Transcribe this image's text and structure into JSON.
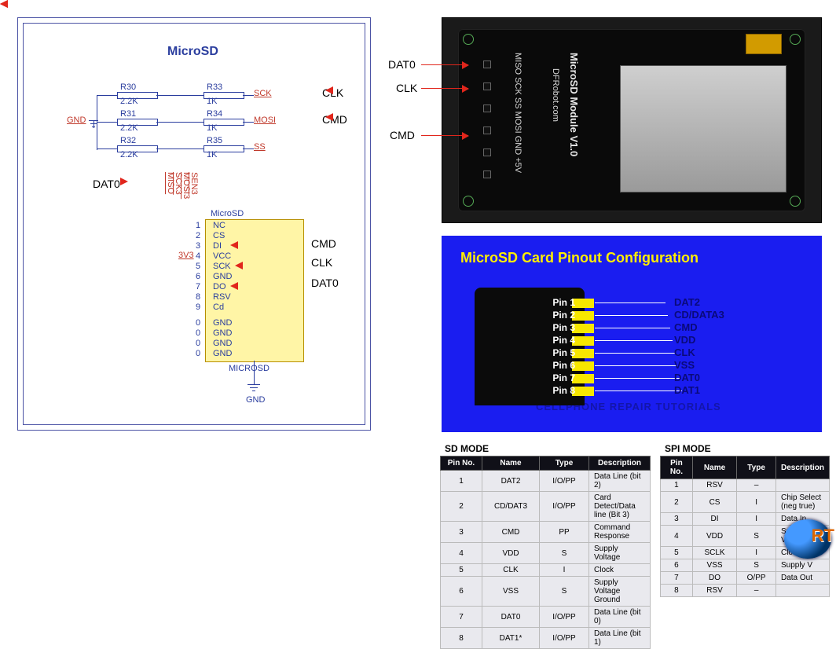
{
  "schematic": {
    "title": "MicroSD",
    "chip_title": "MicroSD",
    "chip_footer": "MICROSD",
    "gnd": "GND",
    "v33": "3V3",
    "components": {
      "R30": {
        "ref": "R30",
        "val": "2.2K"
      },
      "R31": {
        "ref": "R31",
        "val": "2.2K"
      },
      "R32": {
        "ref": "R32",
        "val": "2.2K"
      },
      "R33": {
        "ref": "R33",
        "val": "1K"
      },
      "R34": {
        "ref": "R34",
        "val": "1K"
      },
      "R35": {
        "ref": "R35",
        "val": "1K"
      }
    },
    "signals": {
      "sck": "SCK",
      "mosi": "MOSI",
      "ss": "SS",
      "miso": "MISO",
      "sck3": "SCK3",
      "mosi3": "MOSI3",
      "sen3": "SEN3"
    },
    "chip_pins": [
      "NC",
      "CS",
      "DI",
      "VCC",
      "SCK",
      "GND",
      "DO",
      "RSV",
      "Cd"
    ],
    "chip_gnd_pins": [
      "GND",
      "GND",
      "GND",
      "GND"
    ],
    "mapping": {
      "di": "CMD",
      "sck": "CLK",
      "do": "DAT0"
    },
    "callouts": {
      "clk": "CLK",
      "cmd": "CMD",
      "dat0": "DAT0"
    }
  },
  "module": {
    "title_big": "MicroSD Module V1.0",
    "brand": "DFRobot.com",
    "pin_labels": "MISO SCK  SS MOSI GND  +5V",
    "callouts": {
      "dat0": "DAT0",
      "clk": "CLK",
      "cmd": "CMD"
    }
  },
  "pinout": {
    "title": "MicroSD Card Pinout Configuration",
    "pins": [
      {
        "n": "Pin 1",
        "fn": "DAT2"
      },
      {
        "n": "Pin 2",
        "fn": "CD/DATA3"
      },
      {
        "n": "Pin 3",
        "fn": "CMD"
      },
      {
        "n": "Pin 4",
        "fn": "VDD"
      },
      {
        "n": "Pin 5",
        "fn": "CLK"
      },
      {
        "n": "Pin 6",
        "fn": "VSS"
      },
      {
        "n": "Pin 7",
        "fn": "DAT0"
      },
      {
        "n": "Pin 8",
        "fn": "DAT1"
      }
    ],
    "watermark": "CELLPHONE REPAIR TUTORIALS"
  },
  "tables": {
    "sd": {
      "title": "SD MODE",
      "headers": [
        "Pin No.",
        "Name",
        "Type",
        "Description"
      ],
      "rows": [
        [
          "1",
          "DAT2",
          "I/O/PP",
          "Data Line (bit 2)"
        ],
        [
          "2",
          "CD/DAT3",
          "I/O/PP",
          "Card Detect/Data line (Bit 3)"
        ],
        [
          "3",
          "CMD",
          "PP",
          "Command Response"
        ],
        [
          "4",
          "VDD",
          "S",
          "Supply Voltage"
        ],
        [
          "5",
          "CLK",
          "I",
          "Clock"
        ],
        [
          "6",
          "VSS",
          "S",
          "Supply Voltage Ground"
        ],
        [
          "7",
          "DAT0",
          "I/O/PP",
          "Data Line (bit 0)"
        ],
        [
          "8",
          "DAT1*",
          "I/O/PP",
          "Data Line (bit 1)"
        ]
      ]
    },
    "spi": {
      "title": "SPI MODE",
      "headers": [
        "Pin No.",
        "Name",
        "Type",
        "Description"
      ],
      "rows": [
        [
          "1",
          "RSV",
          "–",
          ""
        ],
        [
          "2",
          "CS",
          "I",
          "Chip Select (neg true)"
        ],
        [
          "3",
          "DI",
          "I",
          "Data In"
        ],
        [
          "4",
          "VDD",
          "S",
          "Supply Voltage"
        ],
        [
          "5",
          "SCLK",
          "I",
          "Clock"
        ],
        [
          "6",
          "VSS",
          "S",
          "Supply V"
        ],
        [
          "7",
          "DO",
          "O/PP",
          "Data Out"
        ],
        [
          "8",
          "RSV",
          "–",
          ""
        ]
      ]
    }
  }
}
